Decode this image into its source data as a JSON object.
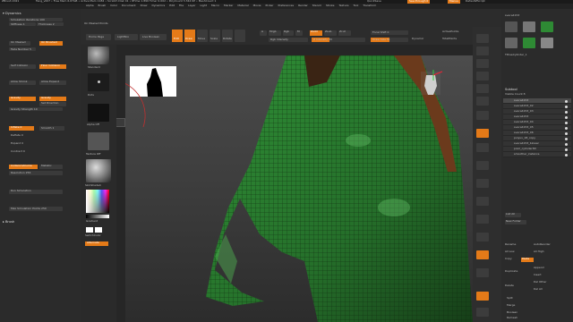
{
  "app": {
    "title": "ZBrush 2021",
    "status": "Fang_v007  • Free Mem 6.67GB • Active Mem 1184 • Scratch Disk 41 • RTime 1.899 Timer 0.002 • PolyCount 3.344 KP • MeshCount 1",
    "quicksave": "QuickSave",
    "see_through": "See-through 0",
    "menus_btn": "Menus",
    "script": "DefaultZScript"
  },
  "menubar": [
    "Alpha",
    "Brush",
    "Color",
    "Document",
    "Draw",
    "Dynamics",
    "Edit",
    "File",
    "Layer",
    "Light",
    "Macro",
    "Marker",
    "Material",
    "Movie",
    "Picker",
    "Preferences",
    "Render",
    "Stencil",
    "Stroke",
    "Texture",
    "Tool",
    "Transform"
  ],
  "leftpanel": {
    "header": "Dynamics",
    "sim_iterations": "Simulation Iterations 100",
    "stiffness": "Stiffness 1",
    "thickness": "Thickness 2",
    "on_masked": "On Masked",
    "on_brushed": "On Brushed",
    "self_collision": "Self Collision",
    "floor_collision": "Floor Collision",
    "allow_shrink": "Allow Shrink",
    "allow_expand": "Allow Expand",
    "gravity": "Gravity",
    "gravity_btn": "Gravity",
    "set_direction": "Set Direction",
    "gravity_strength": "Gravity Strength 10",
    "inflate": "Inflate 0",
    "smooth": "Smooth 1",
    "deflate": "Deflate 0",
    "expand": "Expand 0",
    "contract": "Contract 0",
    "collision_volume": "CollisionVolume",
    "metallic": "Metallic",
    "resolution": "Resolution 256",
    "run_simulation": "Run Simulation",
    "max_sim_points": "Max Simulation Points 250",
    "brush_header": "Brush",
    "tooltip": "On Masked Points"
  },
  "lefticons": {
    "standard": "Standard",
    "dots": "Dots",
    "alpha_off": "Alpha Off",
    "texture_off": "Texture Off",
    "material": "SkinShade4",
    "gradient": "Gradient",
    "switch_color": "SwitchColor",
    "alternate": "Alternate"
  },
  "topshelf": {
    "home": "Home Page",
    "lightbox": "LightBox",
    "live_boolean": "Live Boolean",
    "on_masked_points": "On Masked Points",
    "edit": "Edit",
    "draw": "Draw",
    "move": "Move",
    "scale": "Scale",
    "rotate": "Rotate",
    "a": "A",
    "mrgb": "Mrgb",
    "rgb": "Rgb",
    "m": "M",
    "zadd": "Zadd",
    "zsub": "Zsub",
    "zcut": "Zcut",
    "rgb_intensity": "Rgb Intensity",
    "z_intensity": "Z Intensity 33",
    "focal_shift": "Focal Shift 0",
    "draw_size": "Draw Size 51",
    "dynamic": "Dynamic",
    "active_points": "ActivePoints",
    "total_points": "TotalPoints"
  },
  "rightpanel": {
    "tool_label": "sveca4153",
    "tool_names": [
      "Cylinder3D",
      "PolyMesh3D",
      "SimpleBrush",
      "sveca4153",
      "SveEyes",
      "ZMPolyMesh3D",
      "TPoseCylinder_1"
    ],
    "subtool_header": "Subtool",
    "visible_count": "Visible Count 8",
    "subtools": [
      "sveca4153",
      "sveca4153_02",
      "sveca4153_03",
      "sveca4153",
      "sveca4153_04",
      "sveca4153_05",
      "sveca4153_06",
      "polyuv_18_copy",
      "sveca4153_blower",
      "pixol_cylinder3D",
      "smoother_instance"
    ],
    "list_all": "List All",
    "new_folder": "New Folder",
    "rename": "Rename",
    "auto_reorder": "AutoReorder",
    "all_low": "All Low",
    "all_high": "All High",
    "copy": "Copy",
    "paste": "Paste",
    "duplicate": "Duplicate",
    "append": "Append",
    "insert": "Insert",
    "delete": "Delete",
    "del_other": "Del Other",
    "del_all": "Del All",
    "split": "Split",
    "merge": "Merge",
    "boolean": "Boolean",
    "remesh": "Remesh",
    "project": "Project"
  },
  "rightstrip": [
    "Bpr",
    "SPix 3",
    "Scroll",
    "Zoom",
    "Actual",
    "AAHalf",
    "Persp",
    "Floor",
    "Local",
    "Frame",
    "Move",
    "ZoomD",
    "Rotate",
    "Line Fill",
    "Transp",
    "Ghost",
    "Solo",
    "Xpose"
  ],
  "colors": {
    "accent": "#e47a18",
    "cloth": "#2e8a34",
    "coat_dark": "#1f5a22",
    "strap": "#6b3a1c",
    "bg": "#262626"
  }
}
